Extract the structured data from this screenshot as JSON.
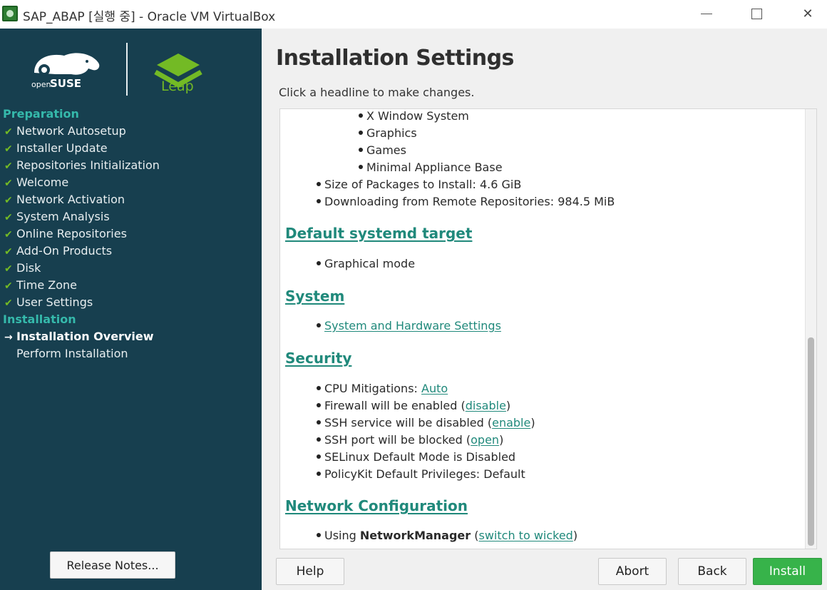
{
  "window": {
    "title": "SAP_ABAP [실행 중] - Oracle VM VirtualBox"
  },
  "sidebar": {
    "leap_label": "Leap",
    "headings": {
      "preparation": "Preparation",
      "installation": "Installation"
    },
    "steps": [
      {
        "label": "Network Autosetup"
      },
      {
        "label": "Installer Update"
      },
      {
        "label": "Repositories Initialization"
      },
      {
        "label": "Welcome"
      },
      {
        "label": "Network Activation"
      },
      {
        "label": "System Analysis"
      },
      {
        "label": "Online Repositories"
      },
      {
        "label": "Add-On Products"
      },
      {
        "label": "Disk"
      },
      {
        "label": "Time Zone"
      },
      {
        "label": "User Settings"
      }
    ],
    "install_steps": [
      {
        "label": "Installation Overview"
      },
      {
        "label": "Perform Installation"
      }
    ],
    "release_notes_label": "Release Notes..."
  },
  "main": {
    "title": "Installation Settings",
    "subtitle": "Click a headline to make changes.",
    "software": {
      "patterns": [
        "X Window System",
        "Graphics",
        "Games",
        "Minimal Appliance Base"
      ],
      "size": "Size of Packages to Install: 4.6 GiB",
      "download": "Downloading from Remote Repositories: 984.5 MiB"
    },
    "systemd": {
      "heading": "Default systemd target",
      "mode": "Graphical mode"
    },
    "system": {
      "heading": "System",
      "link": "System and Hardware Settings"
    },
    "security": {
      "heading": "Security",
      "cpu_prefix": "CPU Mitigations: ",
      "cpu_link": "Auto",
      "firewall_prefix": "Firewall will be enabled (",
      "firewall_link": "disable",
      "ssh_prefix": "SSH service will be disabled (",
      "ssh_link": "enable",
      "port_prefix": "SSH port will be blocked (",
      "port_link": "open",
      "close_paren": ")",
      "selinux": "SELinux Default Mode is Disabled",
      "polkit": "PolicyKit Default Privileges: Default"
    },
    "network": {
      "heading": "Network Configuration",
      "using_prefix": "Using ",
      "manager": "NetworkManager",
      "open_paren": " (",
      "link": "switch to wicked",
      "close_paren": ")"
    },
    "buttons": {
      "help": "Help",
      "abort": "Abort",
      "back": "Back",
      "install": "Install"
    }
  },
  "colors": {
    "sidebar_bg": "#173f4f",
    "accent_teal": "#20897b",
    "check_green": "#73ba25",
    "install_green": "#37b34a"
  }
}
